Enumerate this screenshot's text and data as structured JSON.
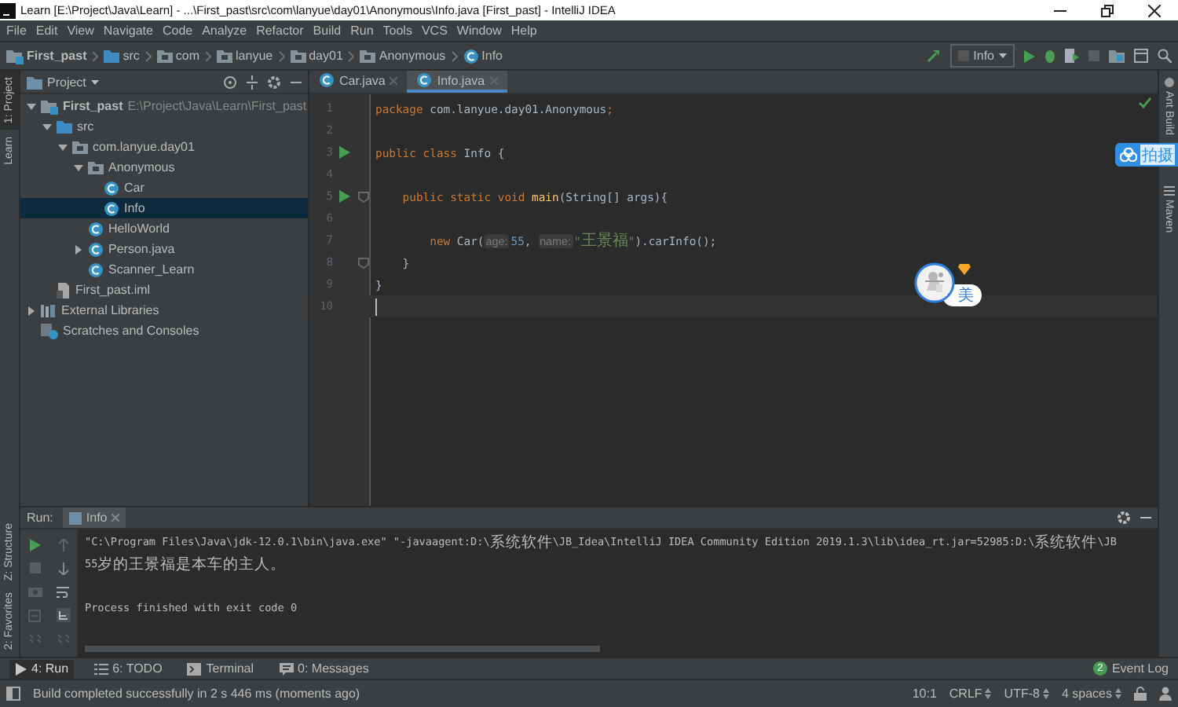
{
  "window": {
    "title": "Learn [E:\\Project\\Java\\Learn] - ...\\First_past\\src\\com\\lanyue\\day01\\Anonymous\\Info.java [First_past] - IntelliJ IDEA"
  },
  "menu": [
    "File",
    "Edit",
    "View",
    "Navigate",
    "Code",
    "Analyze",
    "Refactor",
    "Build",
    "Run",
    "Tools",
    "VCS",
    "Window",
    "Help"
  ],
  "breadcrumbs": [
    {
      "label": "First_past",
      "kind": "project"
    },
    {
      "label": "src",
      "kind": "source"
    },
    {
      "label": "com",
      "kind": "package"
    },
    {
      "label": "lanyue",
      "kind": "package"
    },
    {
      "label": "day01",
      "kind": "package"
    },
    {
      "label": "Anonymous",
      "kind": "package"
    },
    {
      "label": "Info",
      "kind": "class"
    }
  ],
  "toolbar": {
    "run_config": "Info"
  },
  "left_stripe": {
    "top": [
      {
        "label": "1: Project",
        "selected": true
      },
      {
        "label": "Learn",
        "selected": false
      }
    ],
    "bottom": [
      {
        "label": "Z: Structure",
        "selected": false
      },
      {
        "label": "2: Favorites",
        "selected": false
      }
    ]
  },
  "right_stripe": [
    "Ant Build",
    "Maven"
  ],
  "project_panel": {
    "title": "Project",
    "tree": [
      {
        "label": "First_past",
        "kind": "project",
        "note": "E:\\Project\\Java\\Learn\\First_past",
        "selected": false,
        "expanded": true,
        "children": [
          {
            "label": "src",
            "kind": "source",
            "selected": false,
            "expanded": true,
            "children": [
              {
                "label": "com.lanyue.day01",
                "kind": "package",
                "selected": false,
                "expanded": true,
                "children": [
                  {
                    "label": "Anonymous",
                    "kind": "package",
                    "selected": false,
                    "expanded": true,
                    "children": [
                      {
                        "label": "Car",
                        "kind": "class",
                        "selected": false
                      },
                      {
                        "label": "Info",
                        "kind": "class",
                        "selected": true
                      }
                    ]
                  },
                  {
                    "label": "HelloWorld",
                    "kind": "class",
                    "selected": false
                  },
                  {
                    "label": "Person.java",
                    "kind": "class",
                    "selected": false,
                    "expanded": false
                  },
                  {
                    "label": "Scanner_Learn",
                    "kind": "class",
                    "selected": false
                  }
                ]
              }
            ]
          },
          {
            "label": "First_past.iml",
            "kind": "file",
            "selected": false
          }
        ]
      },
      {
        "label": "External Libraries",
        "kind": "library",
        "selected": false,
        "expanded": false
      },
      {
        "label": "Scratches and Consoles",
        "kind": "scratch",
        "selected": false
      }
    ]
  },
  "editor": {
    "tabs": [
      {
        "label": "Car.java",
        "selected": false
      },
      {
        "label": "Info.java",
        "selected": true
      }
    ],
    "lines": [
      {
        "number": "1",
        "run": false,
        "fold": false,
        "current": false,
        "tokens": [
          {
            "text": "package",
            "kind": "keyword"
          },
          {
            "text": " com.lanyue.day01.Anonymous",
            "kind": "plain"
          },
          {
            "text": ";",
            "kind": "keyword"
          }
        ]
      },
      {
        "number": "2",
        "run": false,
        "fold": false,
        "current": false
      },
      {
        "number": "3",
        "run": true,
        "fold": false,
        "current": false,
        "tokens": [
          {
            "text": "public class",
            "kind": "keyword"
          },
          {
            "text": " Info {",
            "kind": "plain"
          }
        ]
      },
      {
        "number": "4",
        "run": false,
        "fold": false,
        "current": false
      },
      {
        "number": "5",
        "run": true,
        "fold": true,
        "current": false,
        "tokens": [
          {
            "text": "    public static void",
            "kind": "keyword"
          },
          {
            "text": " main",
            "kind": "method"
          },
          {
            "text": "(String[] args){",
            "kind": "plain"
          }
        ]
      },
      {
        "number": "6",
        "run": false,
        "fold": false,
        "current": false
      },
      {
        "number": "7",
        "run": false,
        "fold": false,
        "current": false,
        "tokens": [
          {
            "text": "        new",
            "kind": "keyword"
          },
          {
            "text": " Car(",
            "kind": "plain"
          },
          {
            "text": "age:",
            "kind": "hint"
          },
          {
            "text": "55",
            "kind": "number"
          },
          {
            "text": ", ",
            "kind": "plain"
          },
          {
            "text": "name:",
            "kind": "hint"
          },
          {
            "text": "\"王景福\"",
            "kind": "string"
          },
          {
            "text": ").carInfo();",
            "kind": "plain"
          }
        ]
      },
      {
        "number": "8",
        "run": false,
        "fold": true,
        "current": false,
        "tokens": [
          {
            "text": "    }",
            "kind": "plain"
          }
        ]
      },
      {
        "number": "9",
        "run": false,
        "fold": false,
        "current": false,
        "tokens": [
          {
            "text": "}",
            "kind": "plain"
          }
        ]
      },
      {
        "number": "10",
        "run": false,
        "fold": false,
        "current": true
      }
    ]
  },
  "run_panel": {
    "title": "Run:",
    "tab": "Info",
    "console": [
      {
        "text": "\"C:\\Program Files\\Java\\jdk-12.0.1\\bin\\java.exe\" \"-javaagent:D:\\系统软件\\JB_Idea\\IntelliJ IDEA Community Edition 2019.1.3\\lib\\idea_rt.jar=52985:D:\\系统软件\\JB",
        "kind": "output"
      },
      {
        "text": "55岁的王景福是本车的主人。",
        "kind": "output"
      },
      {
        "text": "Process finished with exit code 0",
        "kind": "exit"
      }
    ]
  },
  "bottom_bar": {
    "tools": [
      {
        "label": "4: Run",
        "kind": "run",
        "selected": true
      },
      {
        "label": "6: TODO",
        "kind": "todo",
        "selected": false
      },
      {
        "label": "Terminal",
        "kind": "terminal",
        "selected": false
      },
      {
        "label": "0: Messages",
        "kind": "messages",
        "selected": false
      }
    ],
    "event_log": {
      "label": "Event Log",
      "count": "2"
    }
  },
  "status_bar": {
    "message": "Build completed successfully in 2 s 446 ms (moments ago)",
    "position": "10:1",
    "line_separator": "CRLF",
    "encoding": "UTF-8",
    "indent": "4 spaces"
  },
  "overlays": {
    "share_badge": {
      "label": "拍摄"
    },
    "avatar_widget": {
      "label": "美"
    }
  }
}
